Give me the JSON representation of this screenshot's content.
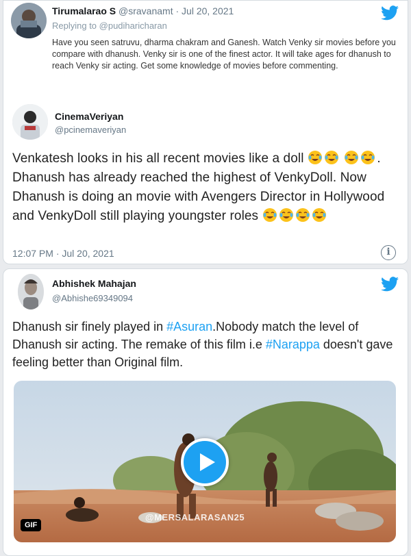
{
  "quoted_tweet": {
    "name": "Tirumalarao S",
    "handle": "@sravanamt",
    "date": "· Jul 20, 2021",
    "replying_to": "Replying to @pudiharicharan",
    "text": "Have you seen satruvu, dharma chakram and Ganesh. Watch Venky sir movies before you compare with dhanush. Venky sir is one of the finest actor. It will take ages for dhanush to reach Venky sir acting. Get some knowledge of movies before commenting."
  },
  "main_tweet": {
    "name": "CinemaVeriyan",
    "handle": "@pcinemaveriyan",
    "text_1": "Venkatesh looks in his all recent movies like a doll",
    "text_2": ". Dhanush has already reached the highest of VenkyDoll. Now Dhanush is doing an movie with Avengers Director in Hollywood and VenkyDoll still playing youngster roles",
    "timestamp": "12:07 PM · Jul 20, 2021"
  },
  "second_tweet": {
    "name": "Abhishek Mahajan",
    "handle": "@Abhishe69349094",
    "text_a": "Dhanush sir finely played in ",
    "tag_1": "#Asuran",
    "text_b": ".Nobody match the level of Dhanush sir acting. The remake of this film i.e ",
    "tag_2": "#Narappa",
    "text_c": " doesn't gave feeling better than Original film.",
    "media_badge": "GIF",
    "watermark": "@MERSALARASAN25"
  },
  "colors": {
    "accent": "#1da1f2",
    "muted": "#657786"
  },
  "icons": [
    "twitter-bird-icon",
    "info-icon",
    "play-icon",
    "laugh-cry-emoji"
  ]
}
